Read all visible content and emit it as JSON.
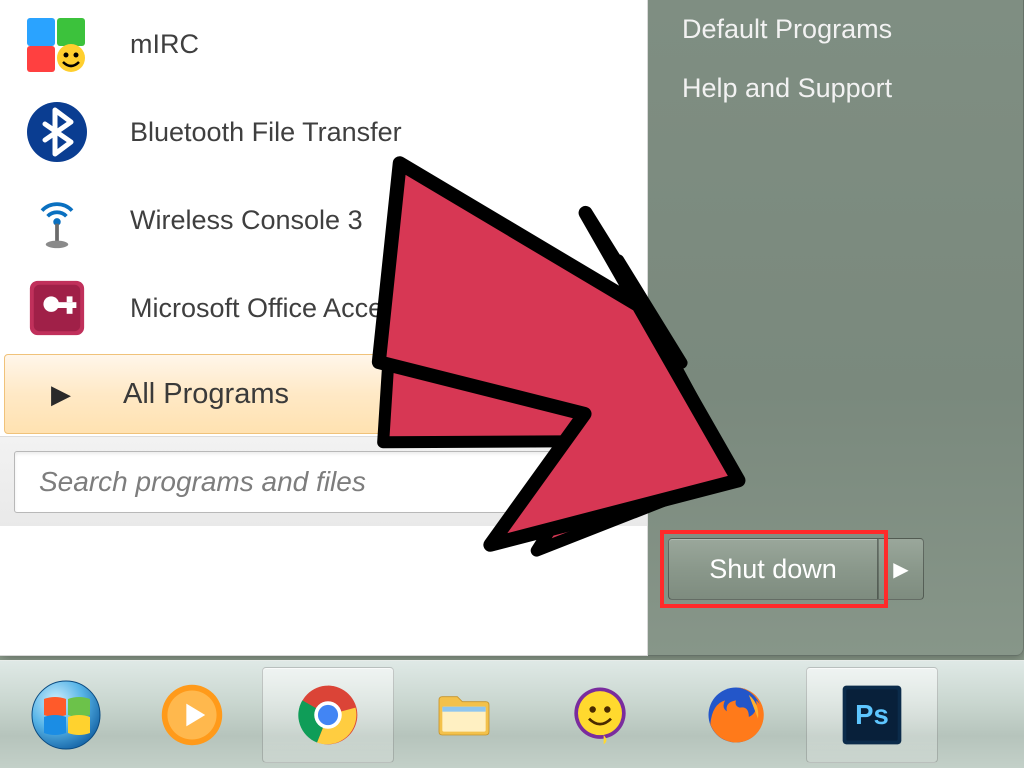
{
  "start_menu": {
    "programs": [
      {
        "label": "mIRC",
        "icon": "mirc-icon",
        "has_submenu": false
      },
      {
        "label": "Bluetooth File Transfer",
        "icon": "bluetooth-icon",
        "has_submenu": false
      },
      {
        "label": "Wireless Console 3",
        "icon": "wireless-icon",
        "has_submenu": false
      },
      {
        "label": "Microsoft Office Access 2007",
        "icon": "access-icon",
        "has_submenu": true
      }
    ],
    "all_programs_label": "All Programs",
    "search_placeholder": "Search programs and files"
  },
  "right_pane": {
    "items": [
      {
        "label": "Default Programs"
      },
      {
        "label": "Help and Support"
      }
    ]
  },
  "shutdown": {
    "label": "Shut down"
  },
  "taskbar": {
    "items": [
      {
        "name": "start-orb-icon",
        "active": false
      },
      {
        "name": "media-player-icon",
        "active": false
      },
      {
        "name": "chrome-icon",
        "active": true
      },
      {
        "name": "explorer-icon",
        "active": false
      },
      {
        "name": "yahoo-messenger-icon",
        "active": false
      },
      {
        "name": "firefox-icon",
        "active": false
      },
      {
        "name": "photoshop-icon",
        "active": true
      }
    ]
  },
  "annotation": {
    "target": "shutdown-button"
  },
  "colors": {
    "highlight": "#ff2a2a",
    "arrow_fill": "#d73754",
    "arrow_stroke": "#000000"
  }
}
